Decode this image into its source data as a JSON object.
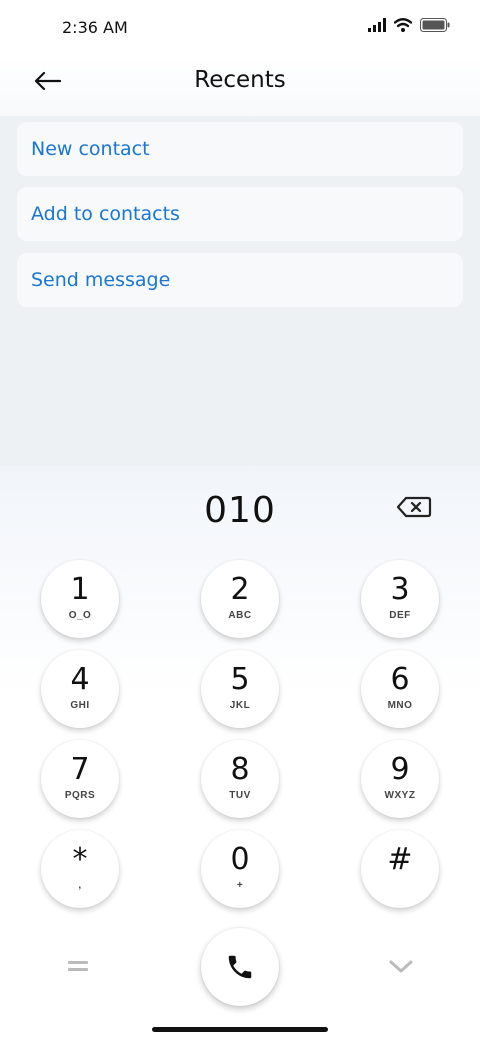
{
  "status_bar": {
    "time": "2:36 AM"
  },
  "header": {
    "title": "Recents"
  },
  "actions": [
    {
      "label": "New contact"
    },
    {
      "label": "Add to contacts"
    },
    {
      "label": "Send message"
    }
  ],
  "dialer": {
    "number": "010",
    "keys": [
      {
        "digit": "1",
        "letters": "O_O"
      },
      {
        "digit": "2",
        "letters": "ABC"
      },
      {
        "digit": "3",
        "letters": "DEF"
      },
      {
        "digit": "4",
        "letters": "GHI"
      },
      {
        "digit": "5",
        "letters": "JKL"
      },
      {
        "digit": "6",
        "letters": "MNO"
      },
      {
        "digit": "7",
        "letters": "PQRS"
      },
      {
        "digit": "8",
        "letters": "TUV"
      },
      {
        "digit": "9",
        "letters": "WXYZ"
      },
      {
        "digit": "*",
        "letters": ","
      },
      {
        "digit": "0",
        "letters": "+"
      },
      {
        "digit": "#",
        "letters": ""
      }
    ]
  },
  "colors": {
    "accent": "#1976d2",
    "list_bg": "#eef1f4",
    "item_bg": "#f8f9fb"
  },
  "icons": [
    "back-arrow-icon",
    "signal-icon",
    "wifi-icon",
    "battery-icon",
    "backspace-icon",
    "menu-icon",
    "phone-icon",
    "chevron-down-icon"
  ]
}
